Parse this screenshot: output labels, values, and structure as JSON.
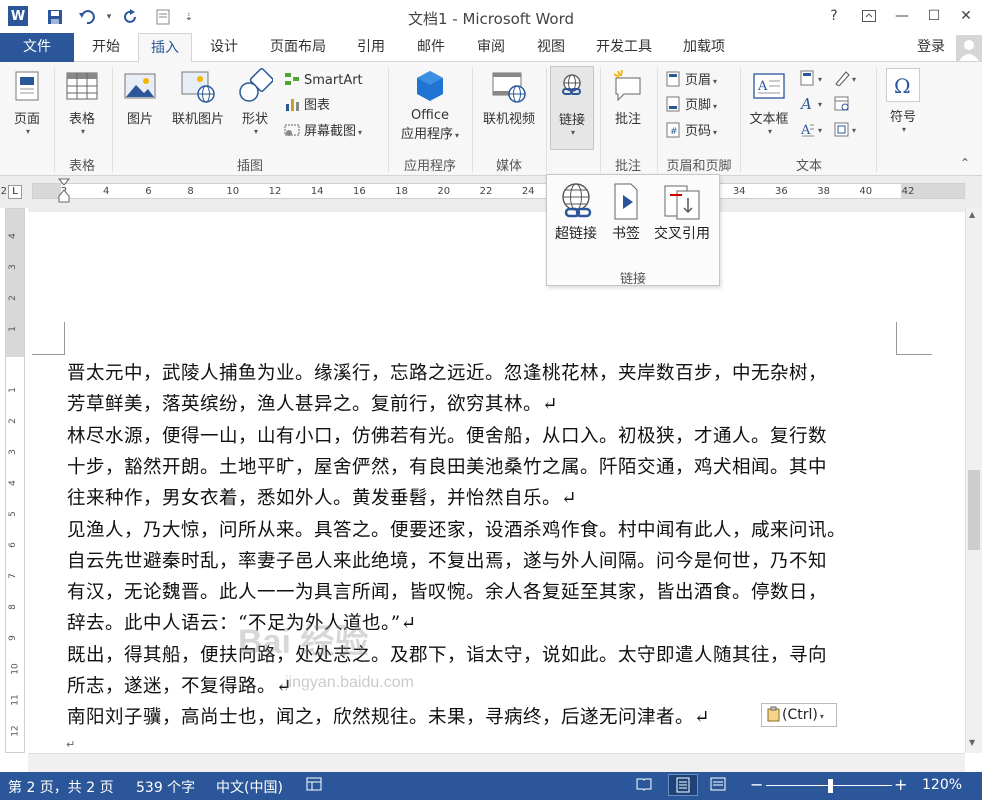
{
  "window": {
    "title": "文档1 - Microsoft Word",
    "help": "?",
    "minimize": "—",
    "restore": "☐",
    "close": "✕",
    "app_icon": "W"
  },
  "tabs": {
    "file": "文件",
    "items": [
      "开始",
      "插入",
      "设计",
      "页面布局",
      "引用",
      "邮件",
      "审阅",
      "视图",
      "开发工具",
      "加载项"
    ],
    "active": "插入",
    "login": "登录"
  },
  "ribbon": {
    "pages": {
      "label": "页面",
      "group": ""
    },
    "table": {
      "label": "表格",
      "group": "表格"
    },
    "illustrations": {
      "picture": "图片",
      "online_picture": "联机图片",
      "shapes": "形状",
      "smartart": "SmartArt",
      "chart": "图表",
      "screenshot": "屏幕截图",
      "group": "插图"
    },
    "apps": {
      "line1": "Office",
      "line2": "应用程序",
      "group": "应用程序"
    },
    "media": {
      "label": "联机视频",
      "group": "媒体"
    },
    "links": {
      "label": "链接"
    },
    "comments": {
      "label": "批注",
      "group": "批注"
    },
    "header_footer": {
      "header": "页眉",
      "footer": "页脚",
      "page_number": "页码",
      "group": "页眉和页脚"
    },
    "text": {
      "textbox": "文本框",
      "group": "文本"
    },
    "symbols": {
      "label": "符号"
    }
  },
  "dropdown": {
    "hyperlink": "超链接",
    "bookmark": "书签",
    "cross_reference": "交叉引用",
    "group": "链接"
  },
  "ruler_ticks": [
    "2",
    "2",
    "4",
    "6",
    "8",
    "10",
    "12",
    "14",
    "16",
    "18",
    "20",
    "22",
    "24",
    "26",
    "28",
    "30",
    "32",
    "34",
    "36",
    "38",
    "40",
    "42"
  ],
  "vruler_ticks": [
    "4",
    "3",
    "2",
    "1",
    "1",
    "2",
    "3",
    "4",
    "5",
    "6",
    "7",
    "8",
    "9",
    "10",
    "11",
    "12"
  ],
  "document": {
    "lines": [
      "晋太元中，武陵人捕鱼为业。缘溪行，忘路之远近。忽逢桃花林，夹岸数百步，中无杂树，",
      "芳草鲜美，落英缤纷，渔人甚异之。复前行，欲穷其林。↵",
      "林尽水源，便得一山，山有小口，仿佛若有光。便舍船，从口入。初极狭，才通人。复行数",
      "十步，豁然开朗。土地平旷，屋舍俨然，有良田美池桑竹之属。阡陌交通，鸡犬相闻。其中",
      "往来种作，男女衣着，悉如外人。黄发垂髫，并怡然自乐。↵",
      "见渔人，乃大惊，问所从来。具答之。便要还家，设酒杀鸡作食。村中闻有此人，咸来问讯。",
      "自云先世避秦时乱，率妻子邑人来此绝境，不复出焉，遂与外人间隔。问今是何世，乃不知",
      "有汉，无论魏晋。此人一一为具言所闻，皆叹惋。余人各复延至其家，皆出酒食。停数日，",
      "辞去。此中人语云：“不足为外人道也。”↵",
      "既出，得其船，便扶向路，处处志之。及郡下，诣太守，说如此。太守即遣人随其往，寻向",
      "所志，遂迷，不复得路。↵",
      "南阳刘子骥，高尚士也，闻之，欣然规往。未果，寻病终，后遂无问津者。↵"
    ],
    "end_mark": "↵",
    "paste_options": "(Ctrl)"
  },
  "watermark": {
    "text": "Bai 经验",
    "sub": "jingyan.baidu.com"
  },
  "status": {
    "page": "第 2 页，共 2 页",
    "words": "539 个字",
    "language": "中文(中国)",
    "zoom": "120%",
    "zoom_minus": "−",
    "zoom_plus": "+"
  },
  "colors": {
    "accent": "#2b579a",
    "statusbar": "#2b579a"
  }
}
